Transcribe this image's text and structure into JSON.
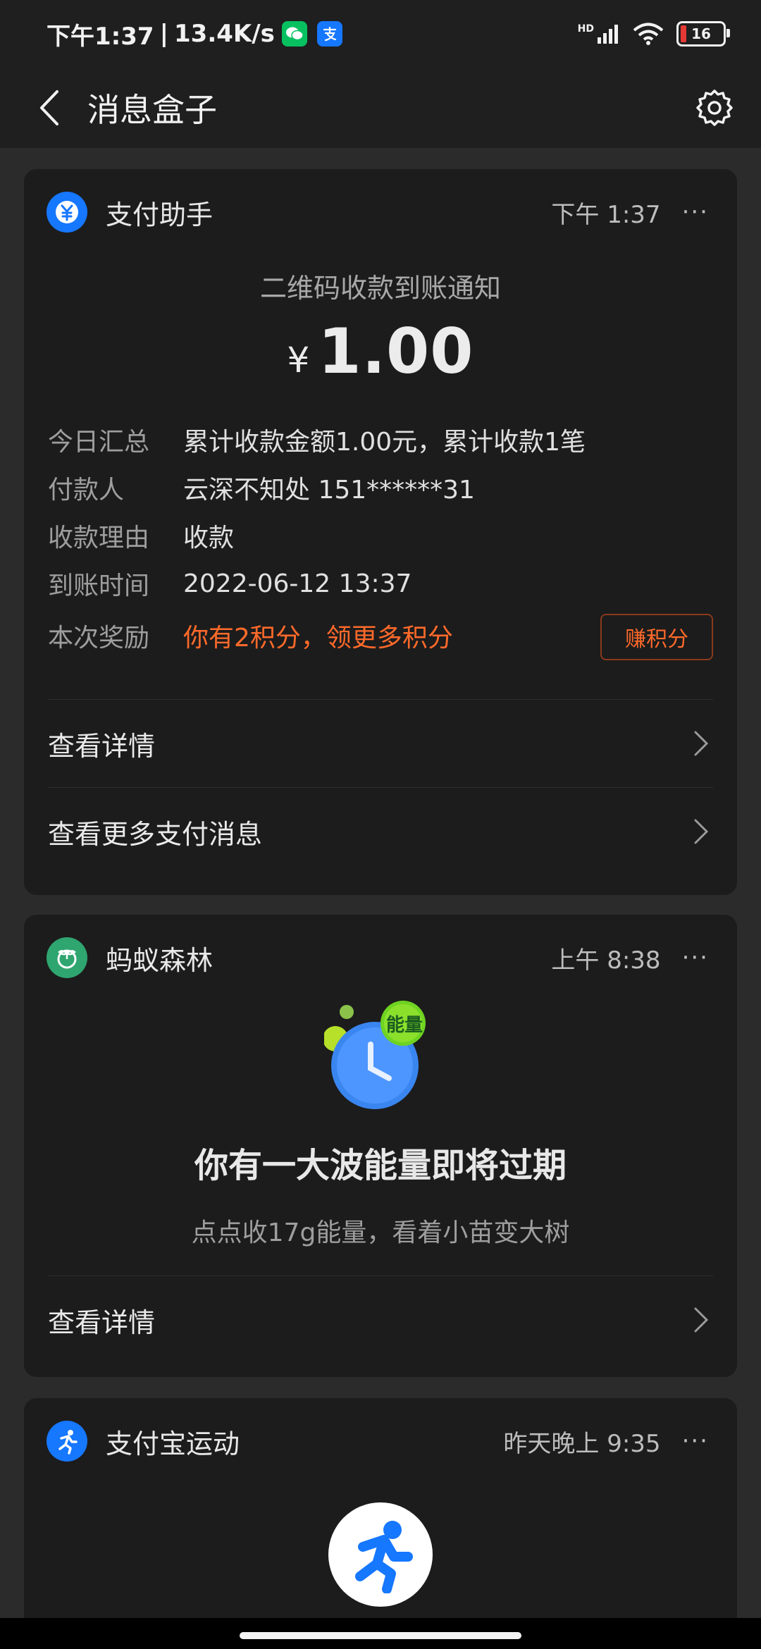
{
  "status_bar": {
    "time": "下午1:37",
    "speed": "13.4K/s",
    "battery": "16",
    "hd_label": "HD"
  },
  "header": {
    "title": "消息盒子"
  },
  "payment_card": {
    "sender": "支付助手",
    "time": "下午 1:37",
    "more": "···",
    "notice_title": "二维码收款到账通知",
    "currency": "¥",
    "amount": "1.00",
    "rows": [
      {
        "key": "今日汇总",
        "value": "累计收款金额1.00元，累计收款1笔"
      },
      {
        "key": "付款人",
        "value": "云深不知处 151******31"
      },
      {
        "key": "收款理由",
        "value": "收款"
      },
      {
        "key": "到账时间",
        "value": "2022-06-12 13:37"
      },
      {
        "key": "本次奖励",
        "value": "你有2积分，领更多积分"
      }
    ],
    "earn_button": "赚积分",
    "view_details": "查看详情",
    "view_more": "查看更多支付消息",
    "accent": "#1677ff",
    "reward_color": "#ff6a2a"
  },
  "forest_card": {
    "sender": "蚂蚁森林",
    "time": "上午 8:38",
    "more": "···",
    "badge": "能量",
    "title": "你有一大波能量即将过期",
    "subtitle": "点点收17g能量，看着小苗变大树",
    "view_details": "查看详情",
    "accent": "#2fa56f"
  },
  "sport_card": {
    "sender": "支付宝运动",
    "time": "昨天晚上 9:35",
    "more": "···",
    "accent": "#1677ff"
  }
}
